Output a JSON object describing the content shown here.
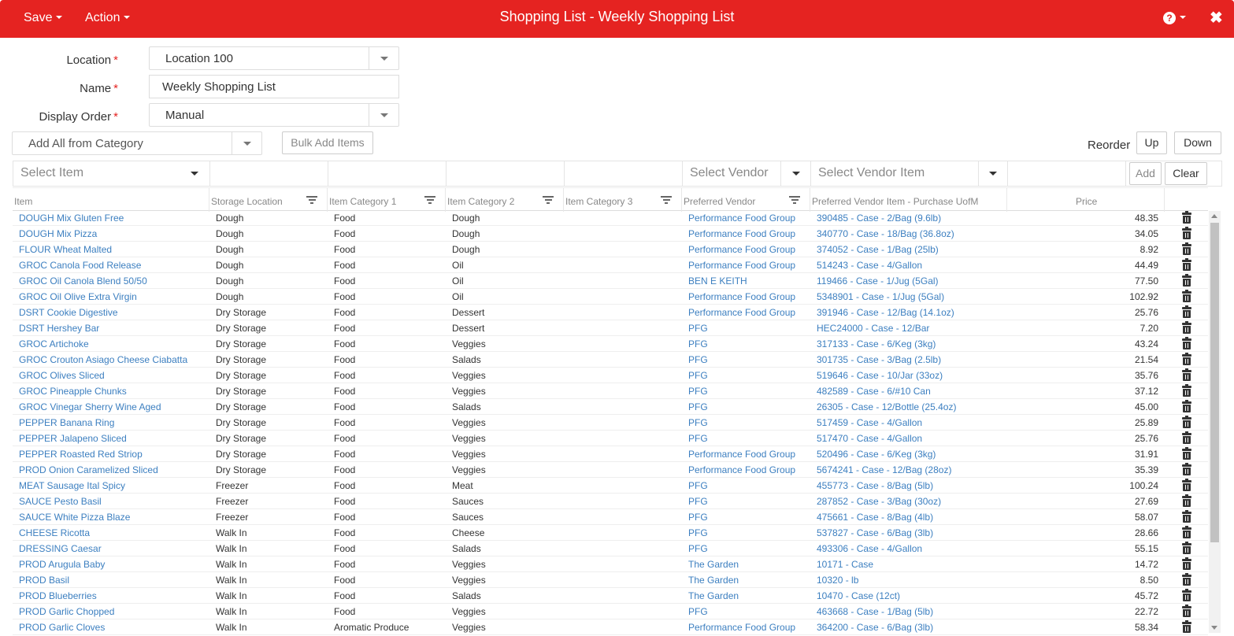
{
  "header": {
    "title": "Shopping List - Weekly Shopping List",
    "save_label": "Save",
    "action_label": "Action",
    "help_glyph": "?",
    "close_glyph": "✖",
    "color": "#e52321"
  },
  "form": {
    "location_label": "Location",
    "location_value": "Location 100",
    "name_label": "Name",
    "name_value": "Weekly Shopping List",
    "display_order_label": "Display Order",
    "display_order_value": "Manual",
    "required_mark": "*"
  },
  "toolbar": {
    "add_all_placeholder": "Add All from Category",
    "bulk_add_label": "Bulk Add Items",
    "reorder_label": "Reorder",
    "up_label": "Up",
    "down_label": "Down"
  },
  "filters": {
    "select_item": "Select Item",
    "select_vendor": "Select Vendor",
    "select_vendor_item": "Select Vendor Item",
    "add_label": "Add",
    "clear_label": "Clear"
  },
  "columns": {
    "item": "Item",
    "storage": "Storage Location",
    "cat1": "Item Category 1",
    "cat2": "Item Category 2",
    "cat3": "Item Category 3",
    "vendor": "Preferred Vendor",
    "vendor_item": "Preferred Vendor Item - Purchase UofM",
    "price": "Price"
  },
  "rows": [
    {
      "item": "DOUGH Mix Gluten Free",
      "storage": "Dough",
      "cat1": "Food",
      "cat2": "Dough",
      "vendor": "Performance Food Group",
      "vendor_item": "390485 - Case - 2/Bag (9.6lb)",
      "price": "48.35"
    },
    {
      "item": "DOUGH Mix Pizza",
      "storage": "Dough",
      "cat1": "Food",
      "cat2": "Dough",
      "vendor": "Performance Food Group",
      "vendor_item": "340770 - Case - 18/Bag (36.8oz)",
      "price": "34.05"
    },
    {
      "item": "FLOUR Wheat Malted",
      "storage": "Dough",
      "cat1": "Food",
      "cat2": "Dough",
      "vendor": "Performance Food Group",
      "vendor_item": "374052 - Case - 1/Bag (25lb)",
      "price": "8.92"
    },
    {
      "item": "GROC Canola Food Release",
      "storage": "Dough",
      "cat1": "Food",
      "cat2": "Oil",
      "vendor": "Performance Food Group",
      "vendor_item": "514243 - Case - 4/Gallon",
      "price": "44.49"
    },
    {
      "item": "GROC Oil Canola Blend 50/50",
      "storage": "Dough",
      "cat1": "Food",
      "cat2": "Oil",
      "vendor": "BEN E KEITH",
      "vendor_item": "119466 - Case - 1/Jug (5Gal)",
      "price": "77.50"
    },
    {
      "item": "GROC Oil Olive Extra Virgin",
      "storage": "Dough",
      "cat1": "Food",
      "cat2": "Oil",
      "vendor": "Performance Food Group",
      "vendor_item": "5348901 - Case - 1/Jug (5Gal)",
      "price": "102.92"
    },
    {
      "item": "DSRT Cookie Digestive",
      "storage": "Dry Storage",
      "cat1": "Food",
      "cat2": "Dessert",
      "vendor": "Performance Food Group",
      "vendor_item": "391946 - Case - 12/Bag (14.1oz)",
      "price": "25.76"
    },
    {
      "item": "DSRT Hershey Bar",
      "storage": "Dry Storage",
      "cat1": "Food",
      "cat2": "Dessert",
      "vendor": "PFG",
      "vendor_item": "HEC24000 - Case - 12/Bar",
      "price": "7.20"
    },
    {
      "item": "GROC Artichoke",
      "storage": "Dry Storage",
      "cat1": "Food",
      "cat2": "Veggies",
      "vendor": "PFG",
      "vendor_item": "317133 - Case - 6/Keg (3kg)",
      "price": "43.24"
    },
    {
      "item": "GROC Crouton Asiago Cheese Ciabatta",
      "storage": "Dry Storage",
      "cat1": "Food",
      "cat2": "Salads",
      "vendor": "PFG",
      "vendor_item": "301735 - Case - 3/Bag (2.5lb)",
      "price": "21.54"
    },
    {
      "item": "GROC Olives Sliced",
      "storage": "Dry Storage",
      "cat1": "Food",
      "cat2": "Veggies",
      "vendor": "PFG",
      "vendor_item": "519646 - Case - 10/Jar (33oz)",
      "price": "35.76"
    },
    {
      "item": "GROC Pineapple Chunks",
      "storage": "Dry Storage",
      "cat1": "Food",
      "cat2": "Veggies",
      "vendor": "PFG",
      "vendor_item": "482589 - Case - 6/#10 Can",
      "price": "37.12"
    },
    {
      "item": "GROC Vinegar Sherry Wine Aged",
      "storage": "Dry Storage",
      "cat1": "Food",
      "cat2": "Salads",
      "vendor": "PFG",
      "vendor_item": "26305 - Case - 12/Bottle (25.4oz)",
      "price": "45.00"
    },
    {
      "item": "PEPPER Banana Ring",
      "storage": "Dry Storage",
      "cat1": "Food",
      "cat2": "Veggies",
      "vendor": "PFG",
      "vendor_item": "517459 - Case - 4/Gallon",
      "price": "25.89"
    },
    {
      "item": "PEPPER Jalapeno Sliced",
      "storage": "Dry Storage",
      "cat1": "Food",
      "cat2": "Veggies",
      "vendor": "PFG",
      "vendor_item": "517470 - Case - 4/Gallon",
      "price": "25.76"
    },
    {
      "item": "PEPPER Roasted Red Striop",
      "storage": "Dry Storage",
      "cat1": "Food",
      "cat2": "Veggies",
      "vendor": "Performance Food Group",
      "vendor_item": "520496 - Case - 6/Keg (3kg)",
      "price": "31.91"
    },
    {
      "item": "PROD Onion Caramelized Sliced",
      "storage": "Dry Storage",
      "cat1": "Food",
      "cat2": "Veggies",
      "vendor": "Performance Food Group",
      "vendor_item": "5674241 - Case - 12/Bag (28oz)",
      "price": "35.39"
    },
    {
      "item": "MEAT Sausage Ital Spicy",
      "storage": "Freezer",
      "cat1": "Food",
      "cat2": "Meat",
      "vendor": "PFG",
      "vendor_item": "455773 - Case - 8/Bag (5lb)",
      "price": "100.24"
    },
    {
      "item": "SAUCE Pesto Basil",
      "storage": "Freezer",
      "cat1": "Food",
      "cat2": "Sauces",
      "vendor": "PFG",
      "vendor_item": "287852 - Case - 3/Bag (30oz)",
      "price": "27.69"
    },
    {
      "item": "SAUCE White Pizza Blaze",
      "storage": "Freezer",
      "cat1": "Food",
      "cat2": "Sauces",
      "vendor": "PFG",
      "vendor_item": "475661 - Case - 8/Bag (4lb)",
      "price": "58.07"
    },
    {
      "item": "CHEESE Ricotta",
      "storage": "Walk In",
      "cat1": "Food",
      "cat2": "Cheese",
      "vendor": "PFG",
      "vendor_item": "537827 - Case - 6/Bag (3lb)",
      "price": "28.66"
    },
    {
      "item": "DRESSING Caesar",
      "storage": "Walk In",
      "cat1": "Food",
      "cat2": "Salads",
      "vendor": "PFG",
      "vendor_item": "493306 - Case - 4/Gallon",
      "price": "55.15"
    },
    {
      "item": "PROD Arugula Baby",
      "storage": "Walk In",
      "cat1": "Food",
      "cat2": "Veggies",
      "vendor": "The Garden",
      "vendor_item": "10171 - Case",
      "price": "14.72"
    },
    {
      "item": "PROD Basil",
      "storage": "Walk In",
      "cat1": "Food",
      "cat2": "Veggies",
      "vendor": "The Garden",
      "vendor_item": "10320 - lb",
      "price": "8.50"
    },
    {
      "item": "PROD Blueberries",
      "storage": "Walk In",
      "cat1": "Food",
      "cat2": "Salads",
      "vendor": "The Garden",
      "vendor_item": "10470 - Case (12ct)",
      "price": "45.72"
    },
    {
      "item": "PROD Garlic Chopped",
      "storage": "Walk In",
      "cat1": "Food",
      "cat2": "Veggies",
      "vendor": "PFG",
      "vendor_item": "463668 - Case - 1/Bag (5lb)",
      "price": "22.72"
    },
    {
      "item": "PROD Garlic Cloves",
      "storage": "Walk In",
      "cat1": "Aromatic Produce",
      "cat2": "Veggies",
      "vendor": "Performance Food Group",
      "vendor_item": "364200 - Case - 6/Bag (3lb)",
      "price": "58.34"
    }
  ]
}
